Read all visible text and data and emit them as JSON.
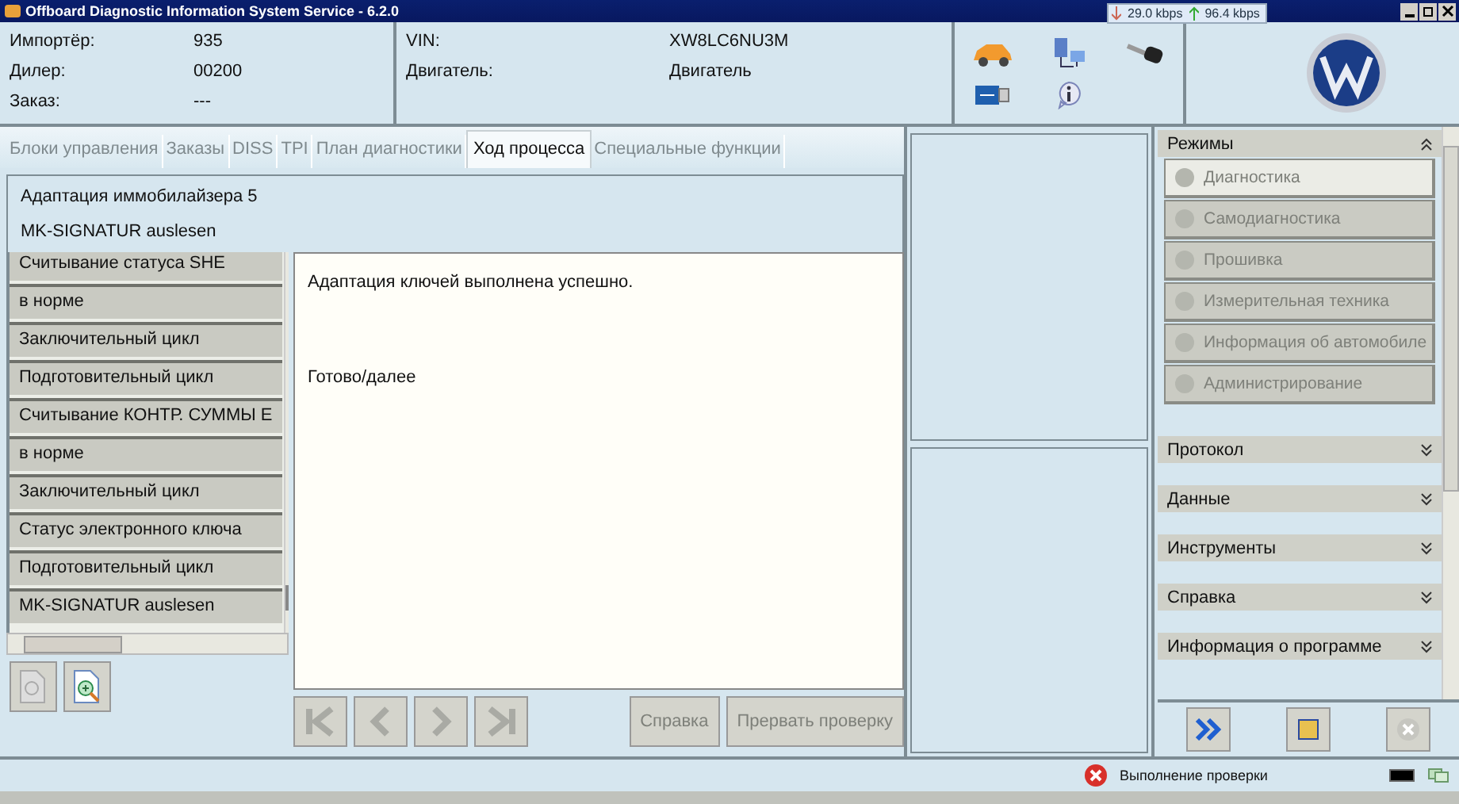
{
  "window": {
    "title": "Offboard Diagnostic Information System Service - 6.2.0"
  },
  "net_meter": {
    "download": "29.0 kbps",
    "upload": "96.4 kbps"
  },
  "info_left": [
    {
      "label": "Импортёр:",
      "value": "935"
    },
    {
      "label": "Дилер:",
      "value": "00200"
    },
    {
      "label": "Заказ:",
      "value": "---"
    }
  ],
  "info_right": [
    {
      "label": "VIN:",
      "value": "XW8LC6NU3M"
    },
    {
      "label": "Двигатель:",
      "value": "Двигатель"
    }
  ],
  "tabs": [
    {
      "label": "Блоки управления",
      "selected": false
    },
    {
      "label": "Заказы",
      "selected": false
    },
    {
      "label": "DISS",
      "selected": false
    },
    {
      "label": "TPI",
      "selected": false
    },
    {
      "label": "План диагностики",
      "selected": false
    },
    {
      "label": "Ход процесса",
      "selected": true
    },
    {
      "label": "Специальные функции",
      "selected": false
    }
  ],
  "process": {
    "title": "Адаптация иммобилайзера 5",
    "subtitle": "MK-SIGNATUR auslesen"
  },
  "steps": [
    "Считывание статуса SHE",
    "в норме",
    "Заключительный цикл",
    "Подготовительный цикл",
    "Считывание КОНТР. СУММЫ Е",
    "в норме",
    "Заключительный цикл",
    "Статус электронного ключа",
    "Подготовительный цикл",
    "MK-SIGNATUR auslesen"
  ],
  "message": [
    "Адаптация ключей выполнена успешно.",
    "Готово/далее"
  ],
  "nav_buttons": [
    {
      "label": "Справка",
      "disabled": true
    },
    {
      "label": "Прервать проверку",
      "disabled": true
    }
  ],
  "modes": {
    "title": "Режимы",
    "items": [
      {
        "label": "Диагностика",
        "selected": true,
        "disabled": true
      },
      {
        "label": "Самодиагностика",
        "selected": false,
        "disabled": true
      },
      {
        "label": "Прошивка",
        "selected": false,
        "disabled": true
      },
      {
        "label": "Измерительная техника",
        "selected": false,
        "disabled": true
      },
      {
        "label": "Информация об автомобиле",
        "selected": false,
        "disabled": true
      },
      {
        "label": "Администрирование",
        "selected": false,
        "disabled": true
      }
    ]
  },
  "sections": [
    "Протокол",
    "Данные",
    "Инструменты",
    "Справка",
    "Информация о программе"
  ],
  "status_bar": {
    "text": "Выполнение проверки"
  }
}
